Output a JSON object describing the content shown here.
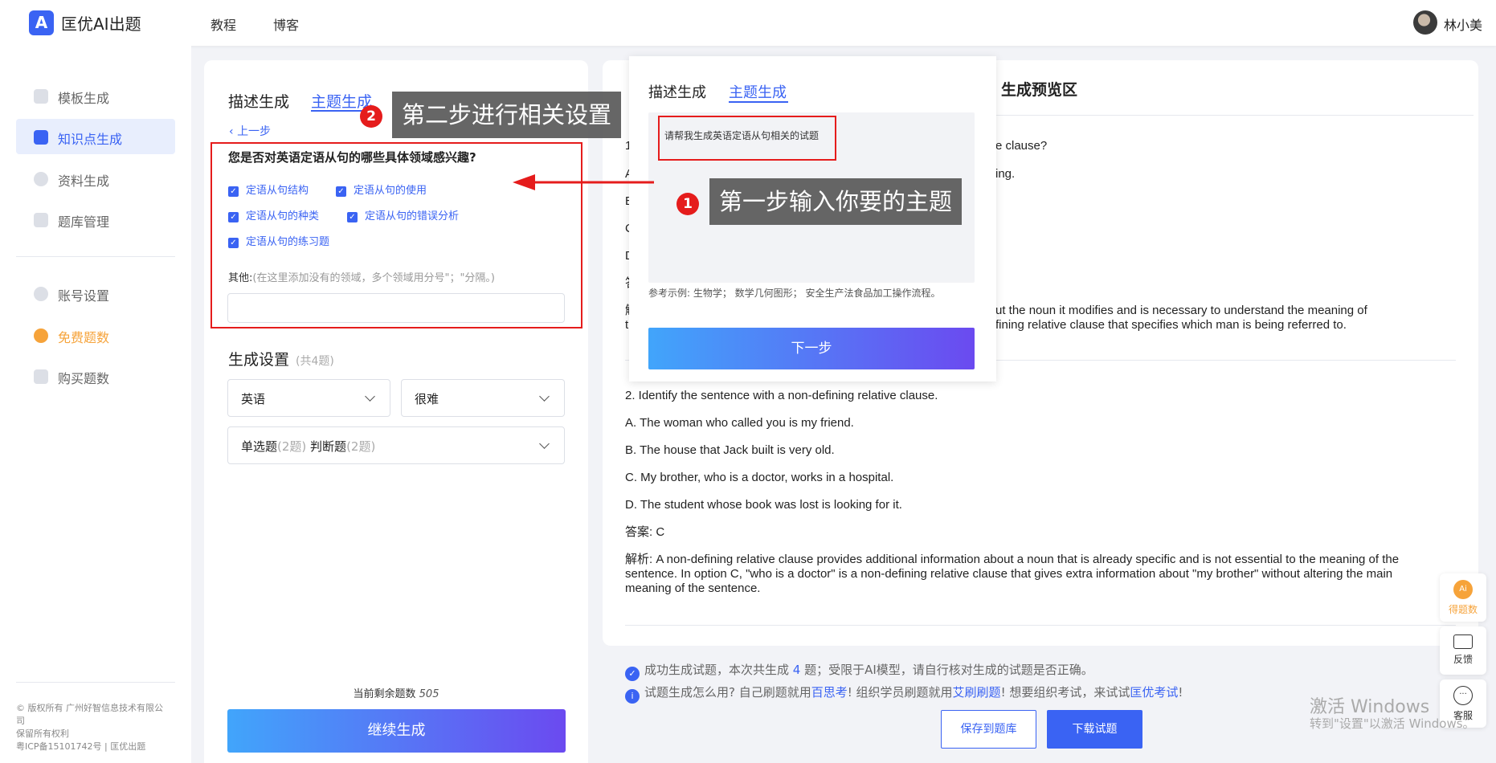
{
  "header": {
    "logo_mark": "A",
    "app_name": "匡优AI出题",
    "nav": [
      "教程",
      "博客"
    ],
    "user_name": "林小美"
  },
  "sidebar": {
    "items": [
      {
        "label": "模板生成",
        "icon": "template-icon"
      },
      {
        "label": "知识点生成",
        "icon": "knowledge-icon"
      },
      {
        "label": "资料生成",
        "icon": "document-icon"
      },
      {
        "label": "题库管理",
        "icon": "question-bank-icon"
      },
      {
        "label": "账号设置",
        "icon": "user-icon"
      },
      {
        "label": "免费题数",
        "icon": "coin-icon"
      },
      {
        "label": "购买题数",
        "icon": "diamond-icon"
      }
    ],
    "footer_lines": [
      "© 版权所有 广州好智信息技术有限公",
      "司",
      "保留所有权利",
      "粤ICP备15101742号 | 匡优出题"
    ]
  },
  "generator": {
    "tabs": [
      "描述生成",
      "主题生成"
    ],
    "back_label": "上一步",
    "question": "您是否对英语定语从句的哪些具体领域感兴趣?",
    "options": [
      "定语从句结构",
      "定语从句的使用",
      "定语从句的种类",
      "定语从句的错误分析",
      "定语从句的练习题"
    ],
    "other_label": "其他:",
    "other_hint": "(在这里添加没有的领域，多个领域用分号\"；\"分隔。)",
    "settings_title": "生成设置",
    "settings_count": "(共4题)",
    "language": "英语",
    "difficulty": "很难",
    "type_single": "单选题",
    "type_single_count": "(2题)",
    "type_judge": "判断题",
    "type_judge_count": "(2题)",
    "remaining_label": "当前剩余题数",
    "remaining_value": "505",
    "continue_label": "继续生成"
  },
  "popup": {
    "tabs": [
      "描述生成",
      "主题生成"
    ],
    "input_text": "请帮我生成英语定语从句相关的试题",
    "example": "参考示例: 生物学；  数学几何图形；  安全生产法食品加工操作流程。",
    "next_label": "下一步"
  },
  "annotations": {
    "step1_num": "1",
    "step1": "第一步输入你要的主题",
    "step2_num": "2",
    "step2": "第二步进行相关设置"
  },
  "preview": {
    "title": "生成预览区",
    "q1_fragments": {
      "l1_left": "1",
      "l1_right": "e clause?",
      "l2_left": "A",
      "l2_right": "ing.",
      "l3": "B",
      "l4": "C",
      "l5": "D",
      "l6": "答",
      "l7_left": "解",
      "l7_right": "ut the noun it modifies and is necessary to understand the meaning of",
      "l8_left": "t",
      "l8_right": "fining relative clause that specifies which man is being referred to."
    },
    "q2": {
      "question": "2. Identify the sentence with a non-defining relative clause.",
      "a": "A. The woman who called you is my friend.",
      "b": "B. The house that Jack built is very old.",
      "c": "C. My brother, who is a doctor, works in a hospital.",
      "d": "D. The student whose book was lost is looking for it.",
      "answer": "答案: C",
      "explanation": "解析: A non-defining relative clause provides additional information about a noun that is already specific and is not essential to the meaning of the sentence. In option C, \"who is a doctor\" is a non-defining relative clause that gives extra information about \"my brother\" without altering the main meaning of the sentence."
    }
  },
  "status": {
    "success_pre": "成功生成试题，本次共生成",
    "success_count": "4",
    "success_post": "题；受限于AI模型，请自行核对生成的试题是否正确。",
    "tip_pre": "试题生成怎么用? 自己刷题就用",
    "tip_link1": "百思考",
    "tip_mid1": "! 组织学员刷题就用",
    "tip_link2": "艾刷刷题",
    "tip_mid2": "!  想要组织考试，来试试",
    "tip_link3": "匡优考试",
    "tip_end": "!",
    "save_label": "保存到题库",
    "download_label": "下载试题"
  },
  "floating": {
    "score_label": "得题数",
    "feedback_label": "反馈",
    "service_label": "客服",
    "ai_badge": "Ai"
  },
  "watermark": {
    "line1": "激活 Windows",
    "line2": "转到\"设置\"以激活 Windows。"
  },
  "colors": {
    "primary": "#3a63f3",
    "annotation_red": "#e51c1c",
    "accent_orange": "#f6a33a"
  }
}
